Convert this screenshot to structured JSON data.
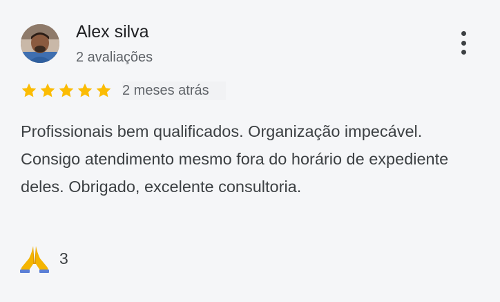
{
  "review": {
    "reviewer_name": "Alex silva",
    "review_count": "2 avaliações",
    "rating": 5,
    "max_rating": 5,
    "date": "2 meses atrás",
    "text": "Profissionais bem qualificados. Organização impecável. Consigo atendimento mesmo fora do horário de expediente deles. Obrigado, excelente consultoria.",
    "reaction_icon": "praying-hands-icon",
    "reaction_count": "3"
  },
  "colors": {
    "star": "#fbbc04",
    "background": "#f5f6f8",
    "text_primary": "#202124",
    "text_secondary": "#5f6368"
  },
  "icons": {
    "menu": "more-vertical-icon",
    "star": "star-icon"
  }
}
